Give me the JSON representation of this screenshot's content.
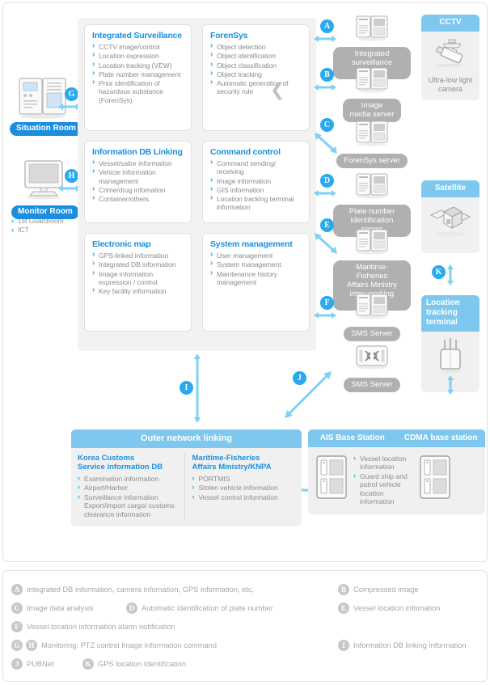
{
  "colors": {
    "accent_blue": "#1a8fe0",
    "light_blue": "#7ec8f0",
    "arrow_blue": "#7fd0f5",
    "badge_gray": "#b0b0b0",
    "panel_gray": "#f2f2f2"
  },
  "left_column": {
    "situation_room_label": "Situation Room",
    "monitor_room_label": "Monitor Room",
    "monitor_sub_items": [
      "1st Guardroom",
      "ICT"
    ]
  },
  "modules": [
    {
      "title": "Integrated Surveillance",
      "items": [
        "CCTV image/control",
        "Location expression",
        "Location tracking (VEW)",
        "Plate number management",
        "Prior identification of hazardous substance (ForenSys)"
      ]
    },
    {
      "title": "ForenSys",
      "items": [
        "Object detection",
        "Object identification",
        "Object classification",
        "Object tracking",
        "Automatic generation of security rule"
      ]
    },
    {
      "title": "Information DB Linking",
      "items": [
        "Vessel/sailor information",
        "Vehicle information management",
        "Crime/drug infomation",
        "Container/others"
      ]
    },
    {
      "title": "Command control",
      "items": [
        "Command sending/ receiving",
        "Image information",
        "GIS information",
        "Location tracking terminal information"
      ]
    },
    {
      "title": "Electronic map",
      "items": [
        "GPS-linked information",
        "Integrated DB information",
        "Image information expression / control",
        "Key facility information"
      ]
    },
    {
      "title": "System management",
      "items": [
        "User management",
        "System management",
        "Maintenance history management"
      ]
    }
  ],
  "servers": [
    {
      "label": "Integrated\nsurveillance server",
      "icon": "server-icon"
    },
    {
      "label": "Image\nmedia server",
      "icon": "server-icon"
    },
    {
      "label": "ForenSys server",
      "icon": "server-icon"
    },
    {
      "label": "Plate number\nidentification server",
      "icon": "server-icon"
    },
    {
      "label": "Maritime-Fisheries\nAffairs Ministry\ninter-working server",
      "icon": "server-icon"
    },
    {
      "label": "SMS Server",
      "icon": "server-icon"
    },
    {
      "label": "SMS Server",
      "icon": "network-switch-icon"
    }
  ],
  "devices": [
    {
      "header": "CCTV",
      "caption": "Ultra-low\nlight camera",
      "icon": "cctv-camera-icon"
    },
    {
      "header": "Satellite",
      "caption": "",
      "icon": "satellite-icon"
    },
    {
      "header": "Location\ntracking\nterminal",
      "caption": "",
      "icon": "tracking-terminal-icon"
    }
  ],
  "connectors": [
    {
      "id": "A",
      "kind": "double-horizontal"
    },
    {
      "id": "B",
      "kind": "double-horizontal"
    },
    {
      "id": "C",
      "kind": "diagonal-down"
    },
    {
      "id": "D",
      "kind": "double-horizontal"
    },
    {
      "id": "E",
      "kind": "diagonal-down"
    },
    {
      "id": "F",
      "kind": "double-horizontal"
    },
    {
      "id": "G",
      "kind": "double-horizontal"
    },
    {
      "id": "H",
      "kind": "double-horizontal"
    },
    {
      "id": "I",
      "kind": "double-vertical"
    },
    {
      "id": "J",
      "kind": "diagonal-up"
    },
    {
      "id": "K",
      "kind": "double-vertical"
    }
  ],
  "bottom_left": {
    "header": "Outer network linking",
    "columns": [
      {
        "title": "Korea Customs\nService information DB",
        "items": [
          "Examination information",
          "Airport/Harbor",
          "Surveillance information Export/import cargo/ customs clearance information"
        ]
      },
      {
        "title": "Maritime-Fisheries\nAffairs Ministry/KNPA",
        "items": [
          "PORTMIS",
          "Stolen vehicle information",
          "Vessel control information"
        ]
      }
    ]
  },
  "bottom_right": {
    "headers": [
      "AIS Base Station",
      "CDMA base station"
    ],
    "items": [
      "Vessel location information",
      "Guard ship and patrol vehicle location information"
    ]
  },
  "legend": {
    "rows": [
      [
        {
          "id": "A",
          "text": "Integrated DB information, camera infomation, GPS information, etc,"
        },
        {
          "id": "B",
          "text": "Compressed image"
        }
      ],
      [
        {
          "id": "C",
          "text": "Image data analysis"
        },
        {
          "id": "D",
          "text": "Automatic identification of plate number"
        },
        {
          "id": "E",
          "text": "Vessel location infomation"
        }
      ],
      [
        {
          "id": "F",
          "text": "Vessel location information alarm notification"
        }
      ],
      [
        {
          "id": "G",
          "text": ""
        },
        {
          "id": "H",
          "text": "Monitoring: PTZ control Image information command"
        },
        {
          "id": "I",
          "text": "Information DB linking information"
        }
      ],
      [
        {
          "id": "J",
          "text": "PUBNet"
        },
        {
          "id": "K",
          "text": "GPS location Identification"
        }
      ]
    ]
  }
}
